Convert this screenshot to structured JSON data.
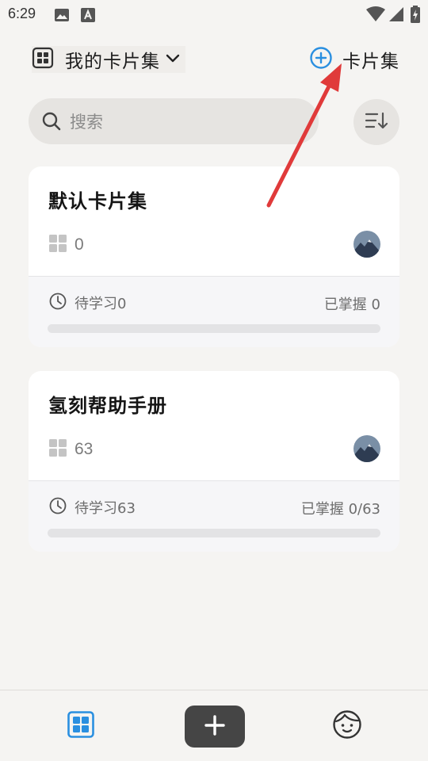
{
  "status_bar": {
    "time": "6:29",
    "icons": [
      "gallery-icon",
      "font-a-icon",
      "wifi-icon",
      "signal-icon",
      "battery-charging-icon"
    ]
  },
  "header": {
    "collection_title": "我的卡片集",
    "add_label": "卡片集",
    "icons": [
      "grid-icon",
      "chevron-down-icon",
      "plus-circle-icon"
    ]
  },
  "search": {
    "placeholder": "搜索"
  },
  "cards": [
    {
      "title": "默认卡片集",
      "count": "0",
      "pending": "待学习0",
      "mastered": "已掌握 0",
      "progress": 0
    },
    {
      "title": "氢刻帮助手册",
      "count": "63",
      "pending": "待学习63",
      "mastered": "已掌握 0/63",
      "progress": 0
    }
  ],
  "bottom_nav": {
    "items": [
      "collections-tab",
      "add-tab",
      "profile-tab"
    ],
    "active": "collections-tab"
  },
  "colors": {
    "accent": "#2a8fe0",
    "annotation_arrow": "#e03a3a",
    "background": "#f5f4f2",
    "nav_add_button": "#454545"
  }
}
